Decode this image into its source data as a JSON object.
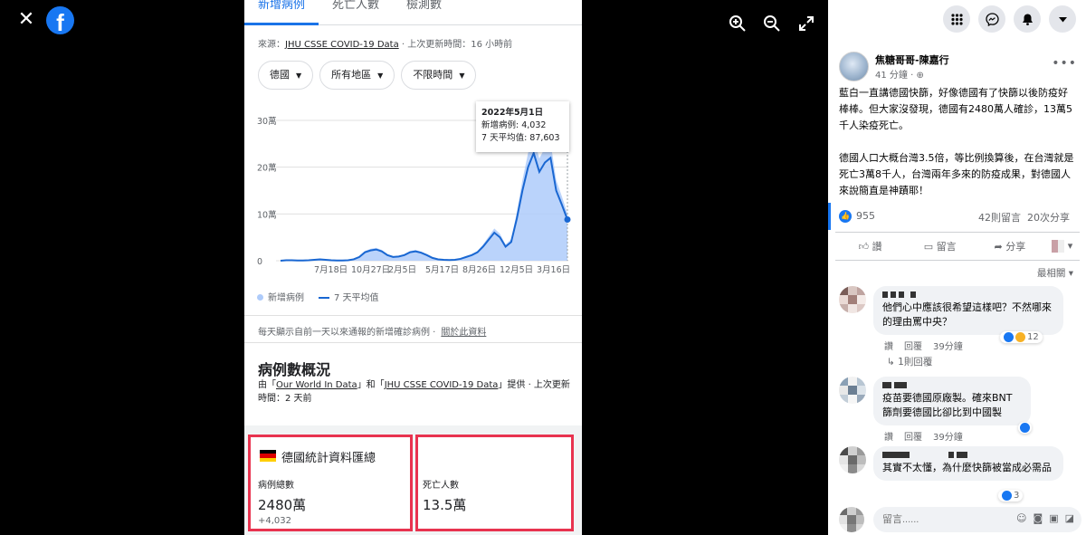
{
  "viewer": {
    "close_label": "✕",
    "logo_text": "f",
    "tools": [
      "zoom-in",
      "zoom-out",
      "fullscreen"
    ]
  },
  "photo": {
    "tabs": [
      "新增病例",
      "死亡人數",
      "檢測數"
    ],
    "source_prefix": "來源：",
    "source_link": "JHU CSSE COVID-19 Data",
    "source_suffix": " · 上次更新時間：16 小時前",
    "filters": [
      "德國",
      "所有地區",
      "不限時間"
    ],
    "tooltip": {
      "date": "2022年5月1日",
      "new_cases": "新增病例: 4,032",
      "avg": "7 天平均值: 87,603"
    },
    "legend": [
      "新增病例",
      "7 天平均值"
    ],
    "note": "每天顯示自前一天以來通報的新增確診病例 ·",
    "note_link": "關於此資料",
    "overview_title": "病例數概況",
    "overview_sub_1": "由「",
    "overview_link_1": "Our World In Data",
    "overview_sub_2": "」和「",
    "overview_link_2": "JHU CSSE COVID-19 Data",
    "overview_sub_3": "」提供 · 上次更新時間：2 天前",
    "box1": {
      "title": "德國統計資料匯總",
      "label": "病例總數",
      "value": "2480萬",
      "delta": "+4,032"
    },
    "box2": {
      "label": "死亡人數",
      "value": "13.5萬"
    }
  },
  "chart_data": {
    "type": "area",
    "yticks": [
      "30萬",
      "20萬",
      "10萬",
      "0"
    ],
    "xticks": [
      "7月18日",
      "10月27日",
      "2月5日",
      "5月17日",
      "8月26日",
      "12月5日",
      "3月16日"
    ],
    "ylim": [
      0,
      300000
    ],
    "series": [
      {
        "name": "7 天平均值",
        "values": [
          0,
          1000,
          1000,
          500,
          500,
          1000,
          2000,
          3000,
          2000,
          1000,
          500,
          500,
          1000,
          3000,
          8000,
          18000,
          22000,
          24000,
          20000,
          12000,
          8000,
          9000,
          12000,
          18000,
          20000,
          17000,
          12000,
          6000,
          3000,
          2000,
          1500,
          2000,
          4000,
          8000,
          12000,
          18000,
          30000,
          45000,
          60000,
          50000,
          30000,
          40000,
          90000,
          150000,
          200000,
          230000,
          190000,
          210000,
          220000,
          150000,
          120000,
          88000
        ]
      }
    ]
  },
  "side": {
    "author": "焦糖哥哥-陳嘉行",
    "time": "41 分鐘 ·",
    "paragraph1": "藍白一直講德國快篩，好像德國有了快篩以後防疫好棒棒。但大家沒發現，德國有2480萬人確診，13萬5千人染疫死亡。",
    "paragraph2": "德國人口大概台灣3.5倍，等比例換算後，在台灣就是死亡3萬8千人，台灣兩年多來的防疫成果，對德國人來說簡直是神蹟耶！",
    "like_count": "955",
    "comments_count": "42則留言",
    "shares_count": "20次分享",
    "actions": [
      "讚",
      "留言",
      "分享"
    ],
    "sort_label": "最相關",
    "comments": [
      {
        "text": "他們心中應該很希望這樣吧？不然哪來的理由罵中央？",
        "like": "讚",
        "reply": "回覆",
        "time": "39分鐘",
        "reactions": "12",
        "replies": "1則回覆"
      },
      {
        "text": "疫苗要德國原廠製。確來BNT篩劑要德國比卻比到中國製",
        "like": "讚",
        "reply": "回覆",
        "time": "39分鐘"
      },
      {
        "text": "其實不太懂，為什麼快篩被當成必需品",
        "reactions": "3"
      }
    ],
    "input_placeholder": "留言......",
    "accent": "#1877f2"
  }
}
